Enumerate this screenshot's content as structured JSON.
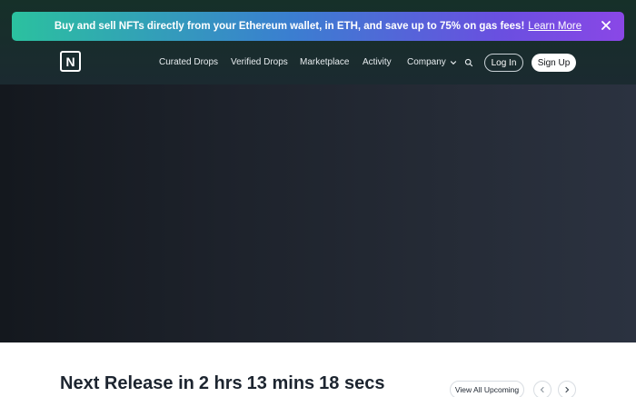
{
  "banner": {
    "text": "Buy and sell NFTs directly from your Ethereum wallet, in ETH, and save up to 75% on gas fees!",
    "link_label": "Learn More",
    "close_icon": "close-icon"
  },
  "nav": {
    "logo_letter": "N",
    "links": [
      "Curated Drops",
      "Verified Drops",
      "Marketplace",
      "Activity",
      "Company"
    ],
    "search_icon": "search-icon",
    "login_label": "Log In",
    "signup_label": "Sign Up"
  },
  "release": {
    "prefix": "Next Release in",
    "hours": "2 hrs",
    "minutes": "13 mins",
    "seconds": "18 secs",
    "view_all_label": "View All Upcoming"
  },
  "colors": {
    "banner_gradient": [
      "#2bc19f",
      "#3a7fd0",
      "#8a47e6"
    ],
    "nav_bg": "#163029",
    "hero_bg": "#1d222b",
    "heading_text": "#1d2530"
  }
}
